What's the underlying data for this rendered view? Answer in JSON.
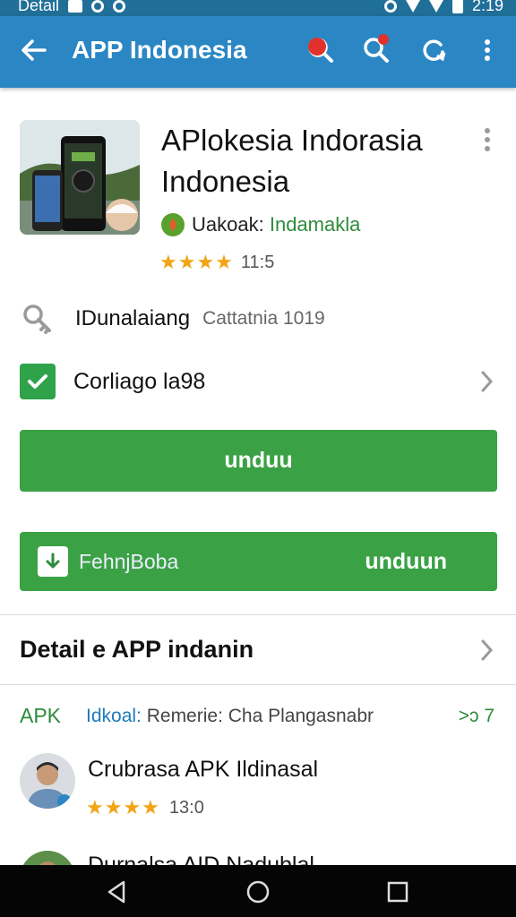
{
  "status_bar": {
    "left_text": "Detail",
    "time": "2:19"
  },
  "app_bar": {
    "title": "APP Indonesia"
  },
  "app": {
    "name": "APlokesia Indorasia Indonesia",
    "vendor_label": "Uakoak:",
    "vendor_value": "Indamakla",
    "stars": "★★★★",
    "rating": "11:5"
  },
  "info": {
    "row1_label": "IDunalaiang",
    "row1_sub": "Cattatnia 1019",
    "row2_label": "Corliago la98"
  },
  "buttons": {
    "primary_label": "unduu",
    "secondary_left": "FehnjBoba",
    "secondary_right": "unduun"
  },
  "detail": {
    "title": "Detail e APP indanin"
  },
  "tabs": {
    "apk": "APK",
    "mid_blue": "Idkoal:",
    "mid_rest": "Remerie:  Cha Plangasnabr",
    "right": ">ɔ 7"
  },
  "reviews": [
    {
      "name": "Crubrasa APK Ildinasal",
      "stars": "★★★★",
      "rating": "13:0"
    },
    {
      "name": "Durnalsa AID Nadublal",
      "stars": "★★★★",
      "rating": ""
    }
  ],
  "icons": {
    "back": "arrow-left-icon",
    "search": "search-icon",
    "overflow": "more-vert-icon",
    "check": "check-icon",
    "download": "download-icon",
    "chevron": "chevron-right-icon"
  },
  "colors": {
    "app_bar": "#2b86c4",
    "status_bar": "#1f6f99",
    "accent_green": "#3aa245"
  }
}
